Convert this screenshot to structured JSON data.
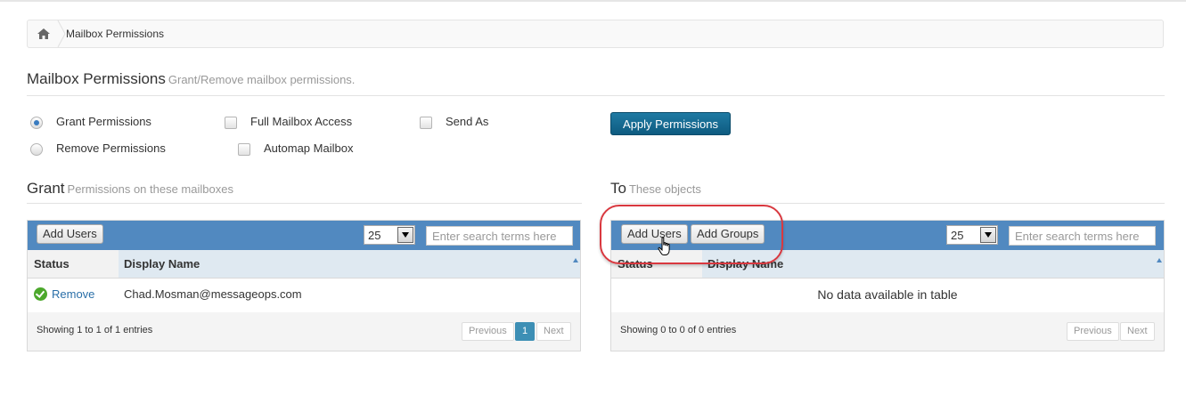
{
  "breadcrumb": {
    "home_icon": "home-icon",
    "label": "Mailbox Permissions"
  },
  "header": {
    "title": "Mailbox Permissions",
    "subtitle": "Grant/Remove mailbox permissions."
  },
  "options": {
    "grant": "Grant Permissions",
    "remove": "Remove Permissions",
    "full_access": "Full Mailbox Access",
    "automap": "Automap Mailbox",
    "send_as": "Send As",
    "selected": "Grant Permissions"
  },
  "apply_button": "Apply Permissions",
  "grant_section": {
    "title": "Grant",
    "subtitle": "Permissions on these mailboxes",
    "add_users": "Add Users",
    "page_size": "25",
    "search_placeholder": "Enter search terms here",
    "columns": [
      "Status",
      "Display Name"
    ],
    "rows": [
      {
        "status": "Remove",
        "display_name": "Chad.Mosman@messageops.com"
      }
    ],
    "info": "Showing 1 to 1 of 1 entries",
    "pagination": {
      "previous": "Previous",
      "page": "1",
      "next": "Next"
    }
  },
  "to_section": {
    "title": "To",
    "subtitle": "These objects",
    "add_users": "Add Users",
    "add_groups": "Add Groups",
    "page_size": "25",
    "search_placeholder": "Enter search terms here",
    "columns": [
      "Status",
      "Display Name"
    ],
    "empty": "No data available in table",
    "info": "Showing 0 to 0 of 0 entries",
    "pagination": {
      "previous": "Previous",
      "next": "Next"
    }
  },
  "colors": {
    "toolbar": "#5189c0",
    "accent": "#0e5b80",
    "highlight": "#d9383f",
    "success": "#4ca82c"
  }
}
